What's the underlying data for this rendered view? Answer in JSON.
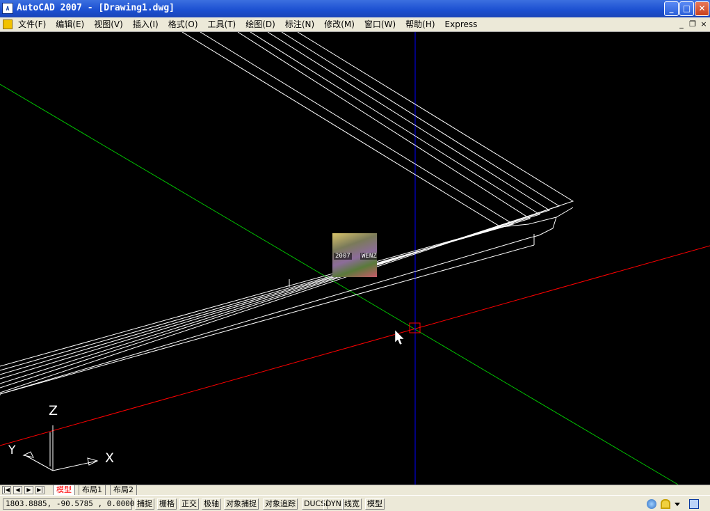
{
  "window": {
    "app_icon_text": "A",
    "title": "AutoCAD 2007 - [Drawing1.dwg]",
    "minimize": "_",
    "maximize": "□",
    "close": "✕"
  },
  "menubar": {
    "items": [
      {
        "label": "文件(F)"
      },
      {
        "label": "编辑(E)"
      },
      {
        "label": "视图(V)"
      },
      {
        "label": "插入(I)"
      },
      {
        "label": "格式(O)"
      },
      {
        "label": "工具(T)"
      },
      {
        "label": "绘图(D)"
      },
      {
        "label": "标注(N)"
      },
      {
        "label": "修改(M)"
      },
      {
        "label": "窗口(W)"
      },
      {
        "label": "帮助(H)"
      },
      {
        "label": "Express"
      }
    ],
    "doc_minimize": "_",
    "doc_restore": "❐",
    "doc_close": "×"
  },
  "viewport": {
    "thumbnail_year": "2007",
    "thumbnail_name": "WENZ",
    "ucs": {
      "z_label": "Z",
      "y_label": "Y",
      "x_label": "X"
    },
    "colors": {
      "background": "#000000",
      "wire": "#ffffff",
      "x_axis": "#ff0000",
      "y_axis": "#00c000",
      "z_axis": "#0000ff"
    }
  },
  "tabs": {
    "nav": [
      "|◀",
      "◀",
      "▶",
      "▶|"
    ],
    "layouts": [
      {
        "label": "模型",
        "active": true
      },
      {
        "label": "布局1",
        "active": false
      },
      {
        "label": "布局2",
        "active": false
      }
    ]
  },
  "statusbar": {
    "coordinates": "1803.8885, -90.5785 , 0.0000",
    "buttons": [
      {
        "label": "捕捉"
      },
      {
        "label": "栅格"
      },
      {
        "label": "正交"
      },
      {
        "label": "极轴"
      },
      {
        "label": "对象捕捉"
      },
      {
        "label": "对象追踪"
      },
      {
        "label": "DUCS"
      },
      {
        "label": "DYN"
      },
      {
        "label": "线宽"
      },
      {
        "label": "模型"
      }
    ],
    "tray_icons": [
      "communication-icon",
      "lock-icon",
      "dropdown-icon",
      "clean-screen-icon"
    ]
  }
}
